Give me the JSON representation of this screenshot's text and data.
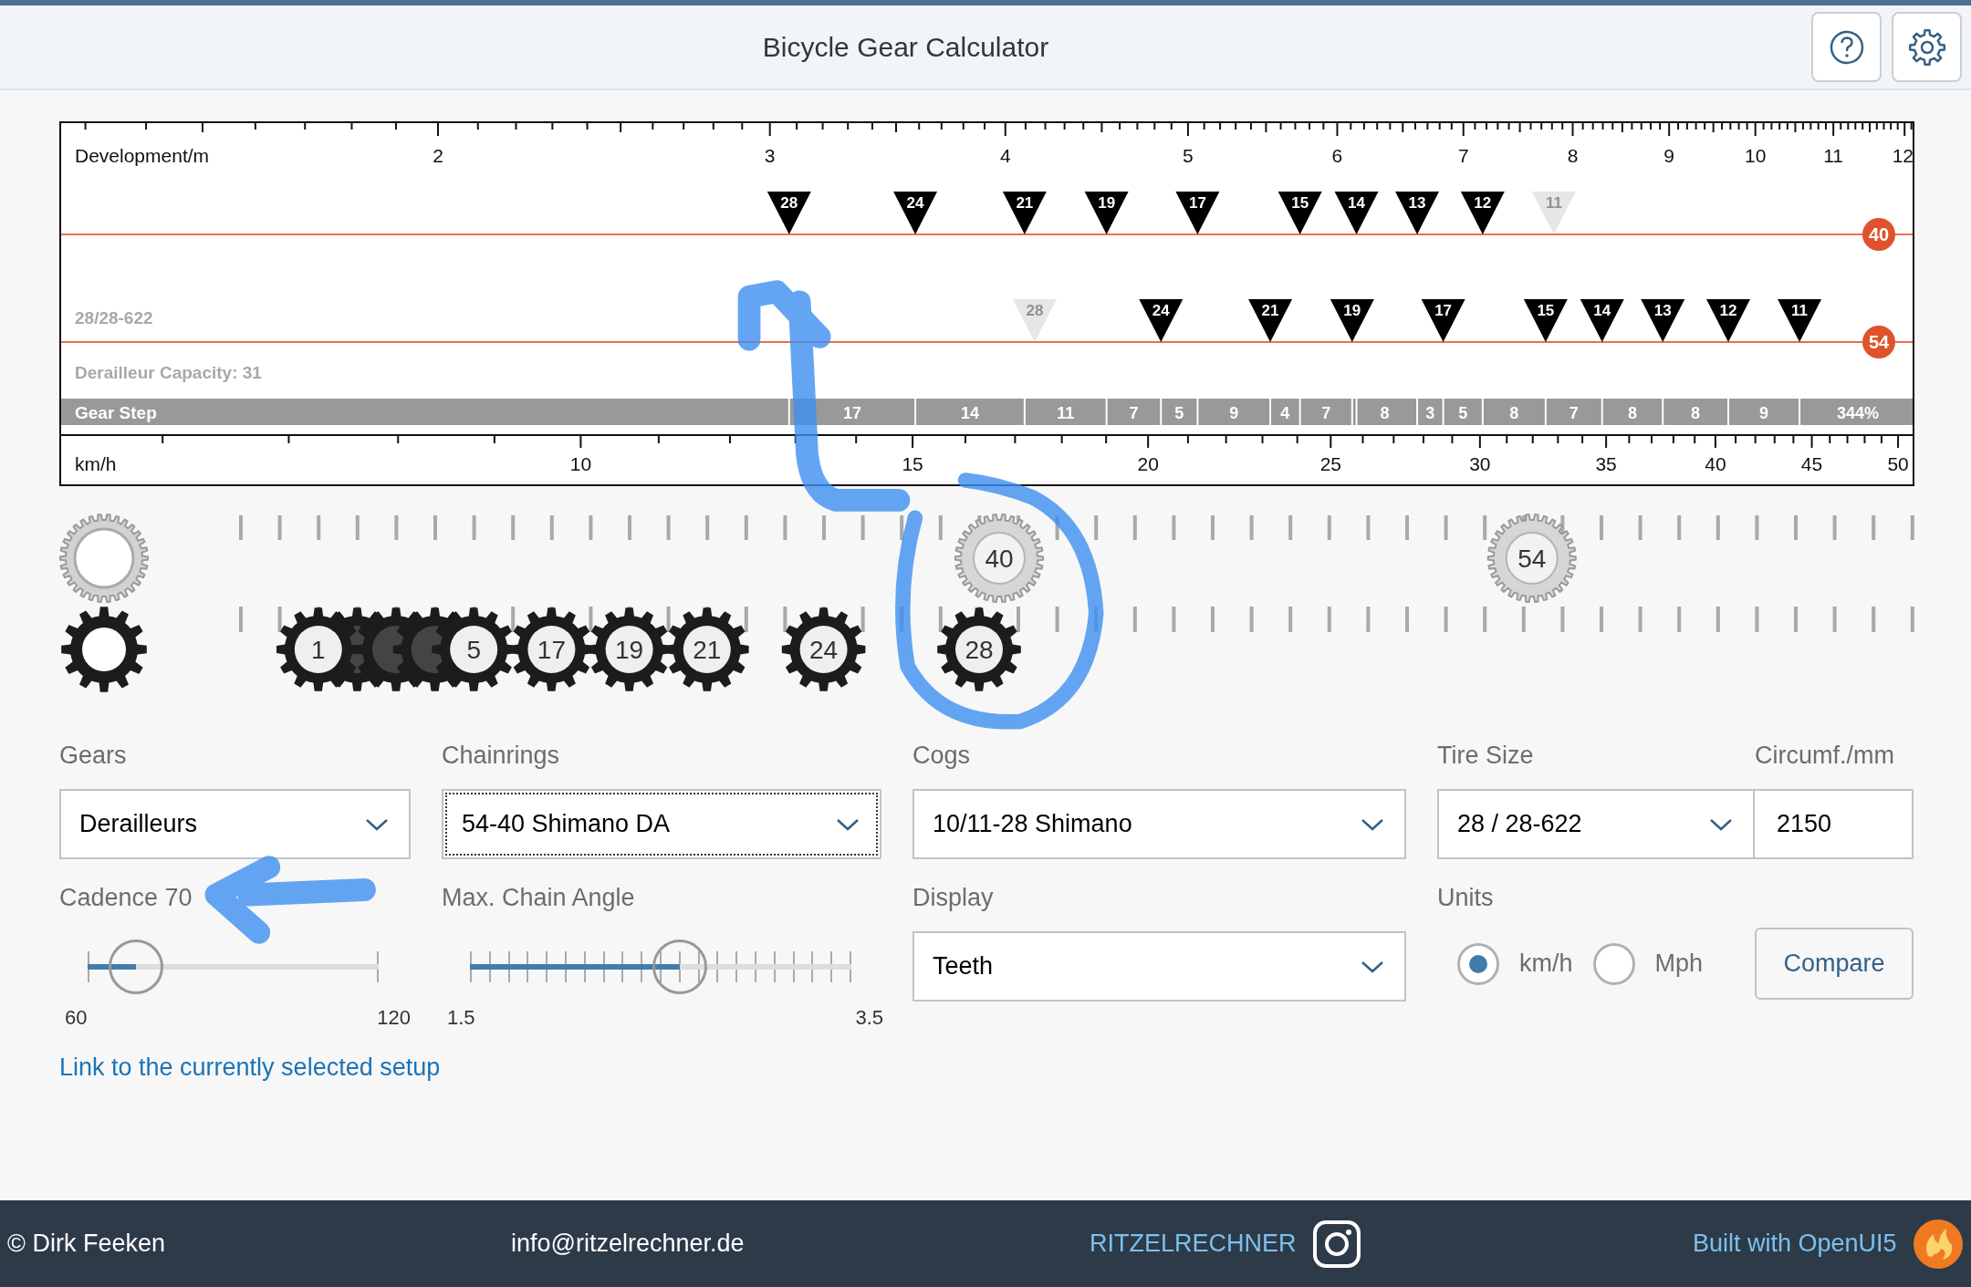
{
  "header": {
    "title": "Bicycle Gear Calculator",
    "buttons": [
      {
        "kind": "help"
      },
      {
        "kind": "settings"
      }
    ]
  },
  "chart": {
    "development_scale": {
      "unit": "Development/m",
      "labels": [
        "2",
        "3",
        "4",
        "5",
        "6",
        "7",
        "8",
        "9",
        "10",
        "11",
        "12"
      ]
    },
    "chainrings": [
      {
        "teeth": "40",
        "cogs": [
          {
            "label": "28",
            "disabled": false
          },
          {
            "label": "24",
            "disabled": false
          },
          {
            "label": "21",
            "disabled": false
          },
          {
            "label": "19",
            "disabled": false
          },
          {
            "label": "17",
            "disabled": false
          },
          {
            "label": "15",
            "disabled": false
          },
          {
            "label": "14",
            "disabled": false
          },
          {
            "label": "13",
            "disabled": false
          },
          {
            "label": "12",
            "disabled": false
          },
          {
            "label": "11",
            "disabled": true
          }
        ]
      },
      {
        "teeth": "54",
        "cogs": [
          {
            "label": "28",
            "disabled": true
          },
          {
            "label": "24",
            "disabled": false
          },
          {
            "label": "21",
            "disabled": false
          },
          {
            "label": "19",
            "disabled": false
          },
          {
            "label": "17",
            "disabled": false
          },
          {
            "label": "15",
            "disabled": false
          },
          {
            "label": "14",
            "disabled": false
          },
          {
            "label": "13",
            "disabled": false
          },
          {
            "label": "12",
            "disabled": false
          },
          {
            "label": "11",
            "disabled": false
          }
        ]
      }
    ],
    "tire_label": "28/28-622",
    "capacity_label": "Derailleur Capacity: 31",
    "gear_step": {
      "label": "Gear Step",
      "steps": [
        "17",
        "14",
        "11",
        "7",
        "5",
        "9",
        "4",
        "7",
        "8",
        "3",
        "5",
        "8",
        "7",
        "8",
        "8",
        "9"
      ],
      "total": "344%"
    },
    "speed_scale": {
      "unit": "km/h",
      "labels": [
        "10",
        "15",
        "20",
        "25",
        "30",
        "35",
        "40",
        "45",
        "50"
      ]
    }
  },
  "gear_preview": {
    "chainrings": [
      {
        "label": "40"
      },
      {
        "label": "54"
      }
    ],
    "cogs": [
      {
        "label": "1",
        "covered": false
      },
      {
        "covered": true
      },
      {
        "covered": true
      },
      {
        "covered": true
      },
      {
        "label": "5",
        "covered": false
      },
      {
        "label": "17",
        "covered": false
      },
      {
        "label": "19",
        "covered": false
      },
      {
        "label": "21",
        "covered": false
      },
      {
        "label": "24",
        "covered": false
      },
      {
        "label": "28",
        "covered": false
      }
    ]
  },
  "settings": {
    "gears": {
      "label": "Gears",
      "value": "Derailleurs",
      "focused": false
    },
    "chainrings": {
      "label": "Chainrings",
      "value": "54-40 Shimano DA",
      "focused": true
    },
    "cogs": {
      "label": "Cogs",
      "value": "10/11-28 Shimano",
      "focused": false
    },
    "tire_size": {
      "label": "Tire Size",
      "value": "28 / 28-622",
      "focused": false
    },
    "circumference": {
      "label": "Circumf./mm",
      "value": "2150"
    },
    "cadence": {
      "label": "Cadence",
      "value": "70",
      "min": "60",
      "max": "120",
      "level": 0.167
    },
    "chain_angle": {
      "label": "Max. Chain Angle",
      "min": "1.5",
      "max": "3.5",
      "level": 0.55
    },
    "display": {
      "label": "Display",
      "value": "Teeth",
      "focused": false
    },
    "units": {
      "label": "Units",
      "options": [
        {
          "label": "km/h",
          "selected": true
        },
        {
          "label": "Mph",
          "selected": false
        }
      ]
    },
    "compare_button": "Compare",
    "link": "Link to the currently selected setup"
  },
  "footer": {
    "author": "© Dirk Feeken",
    "email": "info@ritzelrechner.de",
    "brand": "RITZELRECHNER",
    "built_with": "Built with OpenUI5"
  }
}
